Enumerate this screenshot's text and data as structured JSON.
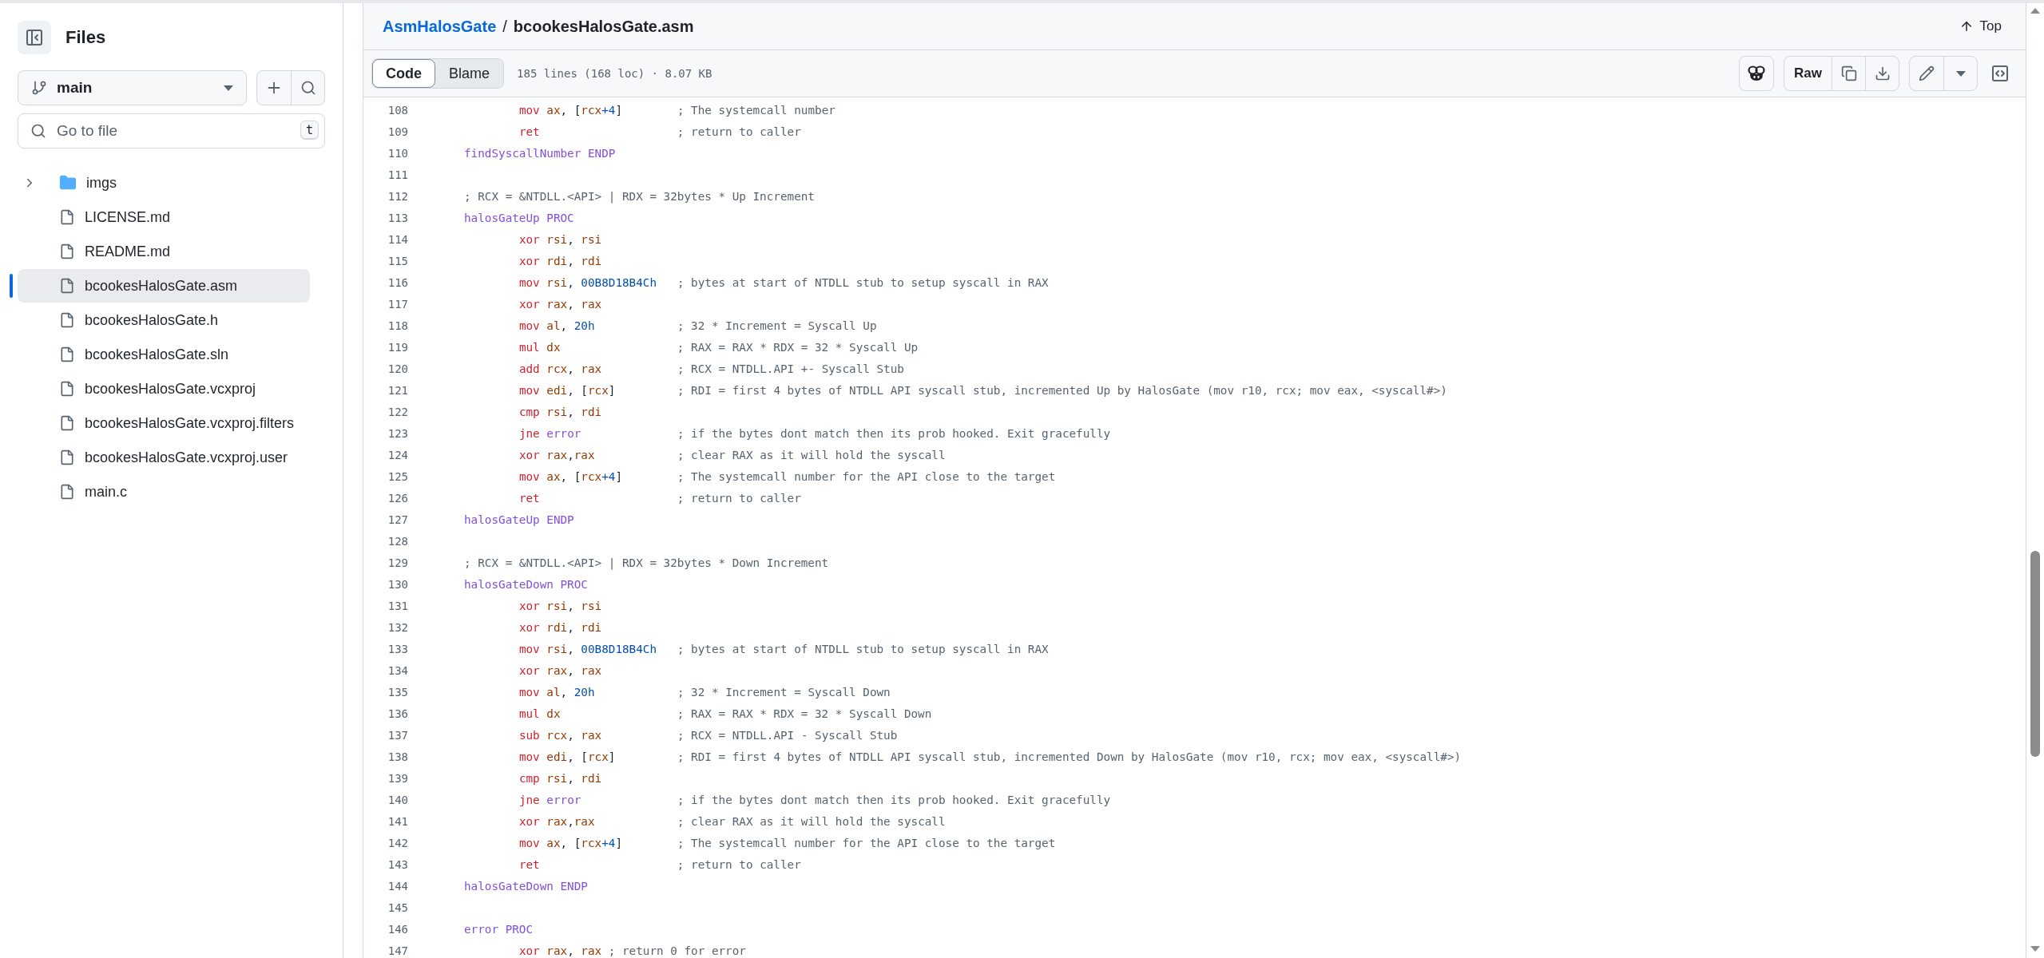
{
  "sidebar": {
    "title": "Files",
    "branch": "main",
    "search": {
      "placeholder": "Go to file",
      "shortcut": "t"
    },
    "tree": [
      {
        "name": "imgs",
        "kind": "folder",
        "expanded": false,
        "selected": false
      },
      {
        "name": "LICENSE.md",
        "kind": "file",
        "selected": false
      },
      {
        "name": "README.md",
        "kind": "file",
        "selected": false
      },
      {
        "name": "bcookesHalosGate.asm",
        "kind": "file",
        "selected": true
      },
      {
        "name": "bcookesHalosGate.h",
        "kind": "file",
        "selected": false
      },
      {
        "name": "bcookesHalosGate.sln",
        "kind": "file",
        "selected": false
      },
      {
        "name": "bcookesHalosGate.vcxproj",
        "kind": "file",
        "selected": false
      },
      {
        "name": "bcookesHalosGate.vcxproj.filters",
        "kind": "file",
        "selected": false
      },
      {
        "name": "bcookesHalosGate.vcxproj.user",
        "kind": "file",
        "selected": false
      },
      {
        "name": "main.c",
        "kind": "file",
        "selected": false
      }
    ]
  },
  "header": {
    "repo": "AsmHalosGate",
    "separator": "/",
    "file": "bcookesHalosGate.asm",
    "top": "Top"
  },
  "toolbar": {
    "tabs": [
      {
        "label": "Code",
        "selected": true
      },
      {
        "label": "Blame",
        "selected": false
      }
    ],
    "info": "185 lines (168 loc) · 8.07 KB",
    "raw": "Raw"
  },
  "code": [
    {
      "number": "108",
      "indented": true,
      "tokens": [
        {
          "kind": "keyword",
          "text": "mov"
        },
        {
          "kind": "register",
          "text": "ax"
        },
        {
          "kind": "plain",
          "text": ", ["
        },
        {
          "kind": "register",
          "text": "rcx"
        },
        {
          "kind": "number",
          "text": "+4"
        },
        {
          "kind": "plain",
          "text": "]"
        }
      ],
      "comment": "; The systemcall number",
      "comment_aligned": true
    },
    {
      "number": "109",
      "indented": true,
      "tokens": [
        {
          "kind": "keyword",
          "text": "ret"
        }
      ],
      "comment": "; return to caller",
      "comment_aligned": true
    },
    {
      "number": "110",
      "indented": false,
      "tokens": [
        {
          "kind": "entity",
          "text": "findSyscallNumber ENDP"
        }
      ]
    },
    {
      "number": "111"
    },
    {
      "number": "112",
      "comment": "; RCX = &NTDLL.<API> | RDX = 32bytes * Up Increment"
    },
    {
      "number": "113",
      "indented": false,
      "tokens": [
        {
          "kind": "entity",
          "text": "halosGateUp PROC"
        }
      ]
    },
    {
      "number": "114",
      "indented": true,
      "tokens": [
        {
          "kind": "keyword",
          "text": "xor"
        },
        {
          "kind": "register",
          "text": "rsi"
        },
        {
          "kind": "plain",
          "text": ","
        },
        {
          "kind": "register",
          "text": "rsi"
        }
      ]
    },
    {
      "number": "115",
      "indented": true,
      "tokens": [
        {
          "kind": "keyword",
          "text": "xor"
        },
        {
          "kind": "register",
          "text": "rdi"
        },
        {
          "kind": "plain",
          "text": ","
        },
        {
          "kind": "register",
          "text": "rdi"
        }
      ]
    },
    {
      "number": "116",
      "indented": true,
      "tokens": [
        {
          "kind": "keyword",
          "text": "mov"
        },
        {
          "kind": "register",
          "text": "rsi"
        },
        {
          "kind": "plain",
          "text": ","
        },
        {
          "kind": "number",
          "text": "00B8D18B4Ch"
        }
      ],
      "comment": "; bytes at start of NTDLL stub to setup syscall in RAX",
      "comment_aligned": true
    },
    {
      "number": "117",
      "indented": true,
      "tokens": [
        {
          "kind": "keyword",
          "text": "xor"
        },
        {
          "kind": "register",
          "text": "rax"
        },
        {
          "kind": "plain",
          "text": ","
        },
        {
          "kind": "register",
          "text": "rax"
        }
      ]
    },
    {
      "number": "118",
      "indented": true,
      "tokens": [
        {
          "kind": "keyword",
          "text": "mov"
        },
        {
          "kind": "register",
          "text": "al"
        },
        {
          "kind": "plain",
          "text": ","
        },
        {
          "kind": "number",
          "text": "20h"
        }
      ],
      "comment": "; 32 * Increment = Syscall Up",
      "comment_aligned": true
    },
    {
      "number": "119",
      "indented": true,
      "tokens": [
        {
          "kind": "keyword",
          "text": "mul"
        },
        {
          "kind": "register",
          "text": "dx"
        }
      ],
      "comment": "; RAX = RAX * RDX = 32 * Syscall Up",
      "comment_aligned": true
    },
    {
      "number": "120",
      "indented": true,
      "tokens": [
        {
          "kind": "keyword",
          "text": "add"
        },
        {
          "kind": "register",
          "text": "rcx"
        },
        {
          "kind": "plain",
          "text": ","
        },
        {
          "kind": "register",
          "text": "rax"
        }
      ],
      "comment": "; RCX = NTDLL.API +- Syscall Stub",
      "comment_aligned": true
    },
    {
      "number": "121",
      "indented": true,
      "tokens": [
        {
          "kind": "keyword",
          "text": "mov"
        },
        {
          "kind": "register",
          "text": "edi"
        },
        {
          "kind": "plain",
          "text": ", ["
        },
        {
          "kind": "register",
          "text": "rcx"
        },
        {
          "kind": "plain",
          "text": "]"
        }
      ],
      "comment": "; RDI = first 4 bytes of NTDLL API syscall stub, incremented Up by HalosGate (mov r10, rcx; mov eax, <syscall#>)",
      "comment_aligned": true
    },
    {
      "number": "122",
      "indented": true,
      "tokens": [
        {
          "kind": "keyword",
          "text": "cmp"
        },
        {
          "kind": "register",
          "text": "rsi"
        },
        {
          "kind": "plain",
          "text": ","
        },
        {
          "kind": "register",
          "text": "rdi"
        }
      ]
    },
    {
      "number": "123",
      "indented": true,
      "tokens": [
        {
          "kind": "keyword",
          "text": "jne"
        },
        {
          "kind": "entity",
          "text": "error"
        }
      ],
      "comment": "; if the bytes dont match then its prob hooked. Exit gracefully",
      "comment_aligned": true
    },
    {
      "number": "124",
      "indented": true,
      "tokens": [
        {
          "kind": "keyword",
          "text": "xor"
        },
        {
          "kind": "register",
          "text": "rax"
        },
        {
          "kind": "plain",
          "text": ",",
          "tight": true
        },
        {
          "kind": "register",
          "text": "rax"
        }
      ],
      "comment": "; clear RAX as it will hold the syscall",
      "comment_aligned": true
    },
    {
      "number": "125",
      "indented": true,
      "tokens": [
        {
          "kind": "keyword",
          "text": "mov"
        },
        {
          "kind": "register",
          "text": "ax"
        },
        {
          "kind": "plain",
          "text": ", ["
        },
        {
          "kind": "register",
          "text": "rcx"
        },
        {
          "kind": "number",
          "text": "+4"
        },
        {
          "kind": "plain",
          "text": "]"
        }
      ],
      "comment": "; The systemcall number for the API close to the target",
      "comment_aligned": true
    },
    {
      "number": "126",
      "indented": true,
      "tokens": [
        {
          "kind": "keyword",
          "text": "ret"
        }
      ],
      "comment": "; return to caller",
      "comment_aligned": true
    },
    {
      "number": "127",
      "indented": false,
      "tokens": [
        {
          "kind": "entity",
          "text": "halosGateUp ENDP"
        }
      ]
    },
    {
      "number": "128"
    },
    {
      "number": "129",
      "comment": "; RCX = &NTDLL.<API> | RDX = 32bytes * Down Increment"
    },
    {
      "number": "130",
      "indented": false,
      "tokens": [
        {
          "kind": "entity",
          "text": "halosGateDown PROC"
        }
      ]
    },
    {
      "number": "131",
      "indented": true,
      "tokens": [
        {
          "kind": "keyword",
          "text": "xor"
        },
        {
          "kind": "register",
          "text": "rsi"
        },
        {
          "kind": "plain",
          "text": ","
        },
        {
          "kind": "register",
          "text": "rsi"
        }
      ]
    },
    {
      "number": "132",
      "indented": true,
      "tokens": [
        {
          "kind": "keyword",
          "text": "xor"
        },
        {
          "kind": "register",
          "text": "rdi"
        },
        {
          "kind": "plain",
          "text": ","
        },
        {
          "kind": "register",
          "text": "rdi"
        }
      ]
    },
    {
      "number": "133",
      "indented": true,
      "tokens": [
        {
          "kind": "keyword",
          "text": "mov"
        },
        {
          "kind": "register",
          "text": "rsi"
        },
        {
          "kind": "plain",
          "text": ","
        },
        {
          "kind": "number",
          "text": "00B8D18B4Ch"
        }
      ],
      "comment": "; bytes at start of NTDLL stub to setup syscall in RAX",
      "comment_aligned": true
    },
    {
      "number": "134",
      "indented": true,
      "tokens": [
        {
          "kind": "keyword",
          "text": "xor"
        },
        {
          "kind": "register",
          "text": "rax"
        },
        {
          "kind": "plain",
          "text": ","
        },
        {
          "kind": "register",
          "text": "rax"
        }
      ]
    },
    {
      "number": "135",
      "indented": true,
      "tokens": [
        {
          "kind": "keyword",
          "text": "mov"
        },
        {
          "kind": "register",
          "text": "al"
        },
        {
          "kind": "plain",
          "text": ","
        },
        {
          "kind": "number",
          "text": "20h"
        }
      ],
      "comment": "; 32 * Increment = Syscall Down",
      "comment_aligned": true
    },
    {
      "number": "136",
      "indented": true,
      "tokens": [
        {
          "kind": "keyword",
          "text": "mul"
        },
        {
          "kind": "register",
          "text": "dx"
        }
      ],
      "comment": "; RAX = RAX * RDX = 32 * Syscall Down",
      "comment_aligned": true
    },
    {
      "number": "137",
      "indented": true,
      "tokens": [
        {
          "kind": "keyword",
          "text": "sub"
        },
        {
          "kind": "register",
          "text": "rcx"
        },
        {
          "kind": "plain",
          "text": ","
        },
        {
          "kind": "register",
          "text": "rax"
        }
      ],
      "comment": "; RCX = NTDLL.API - Syscall Stub",
      "comment_aligned": true
    },
    {
      "number": "138",
      "indented": true,
      "tokens": [
        {
          "kind": "keyword",
          "text": "mov"
        },
        {
          "kind": "register",
          "text": "edi"
        },
        {
          "kind": "plain",
          "text": ", ["
        },
        {
          "kind": "register",
          "text": "rcx"
        },
        {
          "kind": "plain",
          "text": "]"
        }
      ],
      "comment": "; RDI = first 4 bytes of NTDLL API syscall stub, incremented Down by HalosGate (mov r10, rcx; mov eax, <syscall#>)",
      "comment_aligned": true
    },
    {
      "number": "139",
      "indented": true,
      "tokens": [
        {
          "kind": "keyword",
          "text": "cmp"
        },
        {
          "kind": "register",
          "text": "rsi"
        },
        {
          "kind": "plain",
          "text": ","
        },
        {
          "kind": "register",
          "text": "rdi"
        }
      ]
    },
    {
      "number": "140",
      "indented": true,
      "tokens": [
        {
          "kind": "keyword",
          "text": "jne"
        },
        {
          "kind": "entity",
          "text": "error"
        }
      ],
      "comment": "; if the bytes dont match then its prob hooked. Exit gracefully",
      "comment_aligned": true
    },
    {
      "number": "141",
      "indented": true,
      "tokens": [
        {
          "kind": "keyword",
          "text": "xor"
        },
        {
          "kind": "register",
          "text": "rax"
        },
        {
          "kind": "plain",
          "text": ",",
          "tight": true
        },
        {
          "kind": "register",
          "text": "rax"
        }
      ],
      "comment": "; clear RAX as it will hold the syscall",
      "comment_aligned": true
    },
    {
      "number": "142",
      "indented": true,
      "tokens": [
        {
          "kind": "keyword",
          "text": "mov"
        },
        {
          "kind": "register",
          "text": "ax"
        },
        {
          "kind": "plain",
          "text": ", ["
        },
        {
          "kind": "register",
          "text": "rcx"
        },
        {
          "kind": "number",
          "text": "+4"
        },
        {
          "kind": "plain",
          "text": "]"
        }
      ],
      "comment": "; The systemcall number for the API close to the target",
      "comment_aligned": true
    },
    {
      "number": "143",
      "indented": true,
      "tokens": [
        {
          "kind": "keyword",
          "text": "ret"
        }
      ],
      "comment": "; return to caller",
      "comment_aligned": true
    },
    {
      "number": "144",
      "indented": false,
      "tokens": [
        {
          "kind": "entity",
          "text": "halosGateDown ENDP"
        }
      ]
    },
    {
      "number": "145"
    },
    {
      "number": "146",
      "indented": false,
      "tokens": [
        {
          "kind": "entity",
          "text": "error PROC"
        }
      ]
    },
    {
      "number": "147",
      "indented": true,
      "tokens": [
        {
          "kind": "keyword",
          "text": "xor"
        },
        {
          "kind": "register",
          "text": "rax"
        },
        {
          "kind": "plain",
          "text": ","
        },
        {
          "kind": "register",
          "text": "rax"
        }
      ],
      "comment": "; return 0 for error",
      "comment_aligned": false
    }
  ]
}
